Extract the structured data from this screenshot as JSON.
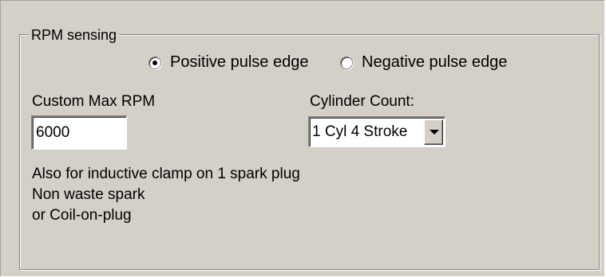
{
  "group": {
    "title": "RPM sensing"
  },
  "pulse_edge": {
    "options": [
      {
        "label": "Positive pulse edge",
        "selected": true
      },
      {
        "label": "Negative pulse edge",
        "selected": false
      }
    ]
  },
  "max_rpm": {
    "label": "Custom Max RPM",
    "value": "6000"
  },
  "cylinder_count": {
    "label": "Cylinder Count:",
    "selected": "1 Cyl 4 Stroke"
  },
  "notes": [
    "Also for inductive clamp on 1 spark plug",
    "Non waste spark",
    "or Coil-on-plug"
  ],
  "colors": {
    "background": "#d4d0c8",
    "field": "#ffffff",
    "shadow": "#808080"
  }
}
